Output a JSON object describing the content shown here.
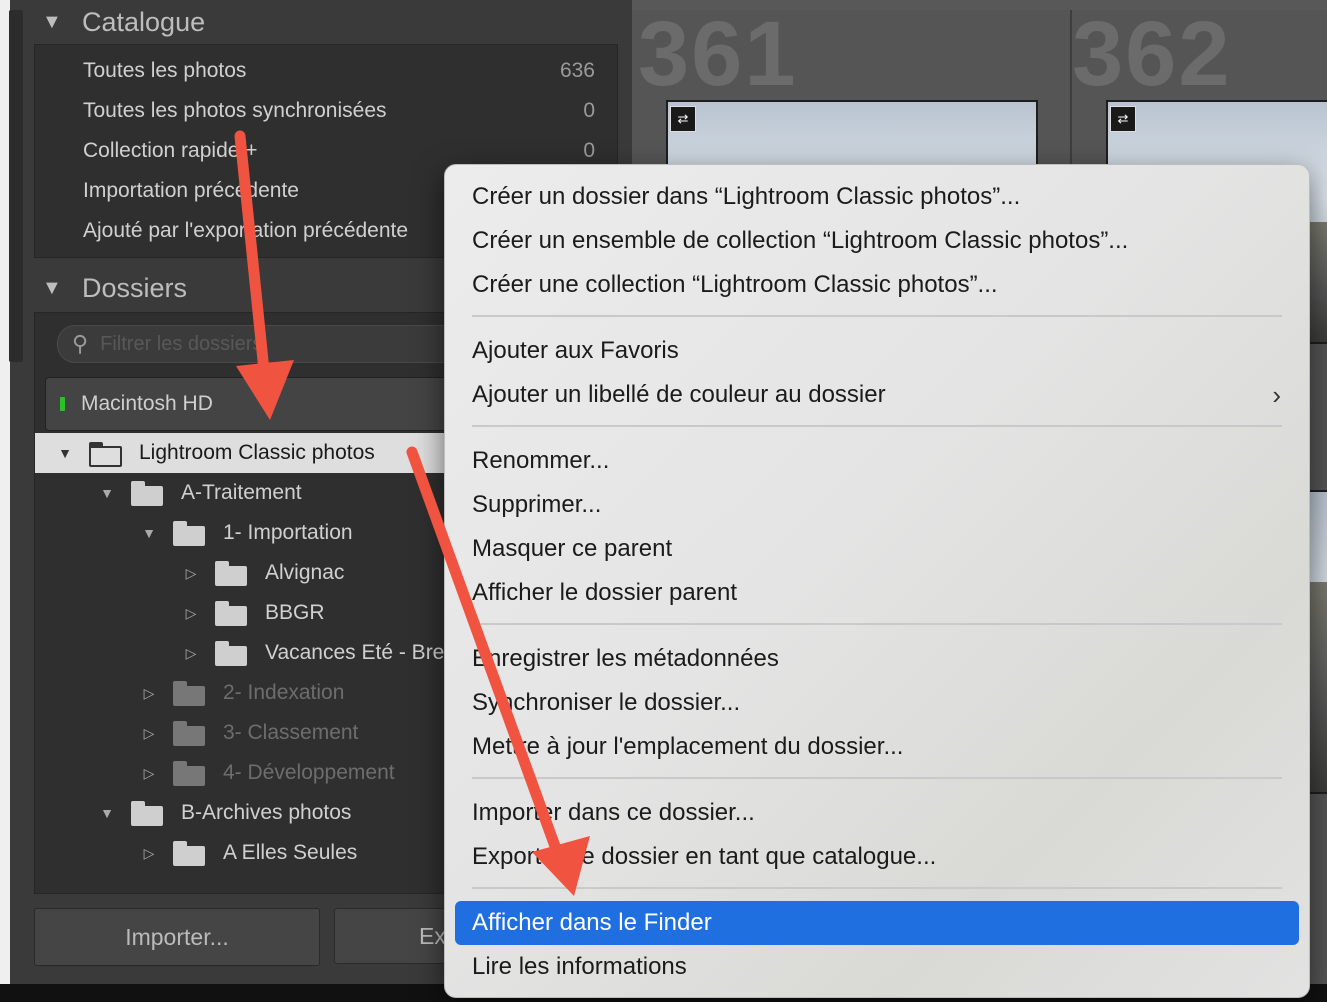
{
  "catalog": {
    "title": "Catalogue",
    "items": [
      {
        "label": "Toutes les photos",
        "count": "636"
      },
      {
        "label": "Toutes les photos synchronisées",
        "count": "0"
      },
      {
        "label": "Collection rapide +",
        "count": "0"
      },
      {
        "label": "Importation précédente",
        "count": ""
      },
      {
        "label": "Ajouté par l'exportation précédente",
        "count": ""
      }
    ]
  },
  "folders": {
    "title": "Dossiers",
    "filter_placeholder": "Filtrer les dossiers",
    "volume": "Macintosh HD",
    "tree": [
      {
        "label": "Lightroom Classic photos",
        "expanded": true,
        "selected": true
      },
      {
        "label": "A-Traitement",
        "expanded": true
      },
      {
        "label": "1- Importation",
        "expanded": true
      },
      {
        "label": "Alvignac"
      },
      {
        "label": "BBGR"
      },
      {
        "label": "Vacances Eté - Bre"
      },
      {
        "label": "2- Indexation",
        "dim": true
      },
      {
        "label": "3- Classement",
        "dim": true
      },
      {
        "label": "4- Développement",
        "dim": true
      },
      {
        "label": "B-Archives photos",
        "expanded": true
      },
      {
        "label": "A Elles Seules"
      }
    ]
  },
  "buttons": {
    "import": "Importer...",
    "export": "Ex"
  },
  "grid": {
    "cells": [
      {
        "number": "361"
      },
      {
        "number": "362"
      }
    ],
    "sync_icon": "sync-arrows-icon"
  },
  "context_menu": {
    "items": [
      "Créer un dossier dans “Lightroom Classic photos”...",
      "Créer un ensemble de collection “Lightroom Classic photos”...",
      "Créer une collection “Lightroom Classic photos”...",
      "Ajouter aux Favoris",
      "Ajouter un libellé de couleur au dossier",
      "Renommer...",
      "Supprimer...",
      "Masquer ce parent",
      "Afficher le dossier parent",
      "Enregistrer les métadonnées",
      "Synchroniser le dossier...",
      "Mettre à jour l'emplacement du dossier...",
      "Importer dans ce dossier...",
      "Exporter ce dossier en tant que catalogue...",
      "Afficher dans le Finder",
      "Lire les informations"
    ],
    "highlighted": "Afficher dans le Finder",
    "highlight_color": "#1f6fe0"
  },
  "annotation_color": "#f0533f"
}
